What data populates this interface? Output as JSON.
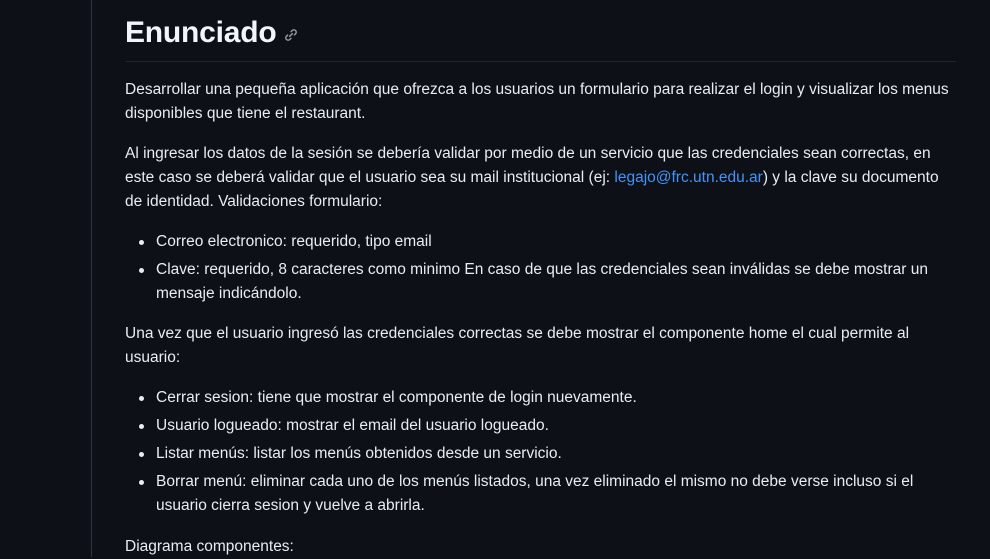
{
  "heading": {
    "title": "Enunciado",
    "anchor_icon": "link-icon"
  },
  "paragraphs": {
    "intro": "Desarrollar una pequeña aplicación que ofrezca a los usuarios un formulario para realizar el login y visualizar los menus disponibles que tiene el restaurant.",
    "session_before": "Al ingresar los datos de la sesión se debería validar por medio de un servicio que las credenciales sean correctas, en este caso se deberá validar que el usuario sea su mail institucional (ej: ",
    "session_link": "legajo@frc.utn.edu.ar",
    "session_after": ") y la clave su documento de identidad. Validaciones formulario:",
    "home_intro": "Una vez que el usuario ingresó las credenciales correctas se debe mostrar el componente home el cual permite al usuario:",
    "diagram": "Diagrama componentes:"
  },
  "validations": [
    "Correo electronico: requerido, tipo email",
    "Clave: requerido, 8 caracteres como minimo En caso de que las credenciales sean inválidas se debe mostrar un mensaje indicándolo."
  ],
  "home_features": [
    "Cerrar sesion: tiene que mostrar el componente de login nuevamente.",
    "Usuario logueado: mostrar el email del usuario logueado.",
    "Listar menús: listar los menús obtenidos desde un servicio.",
    "Borrar menú: eliminar cada uno de los menús listados, una vez eliminado el mismo no debe verse incluso si el usuario cierra sesion y vuelve a abrirla."
  ],
  "colors": {
    "background": "#0d1117",
    "text": "#e6edf3",
    "link": "#4493f8",
    "border": "#30363d"
  }
}
